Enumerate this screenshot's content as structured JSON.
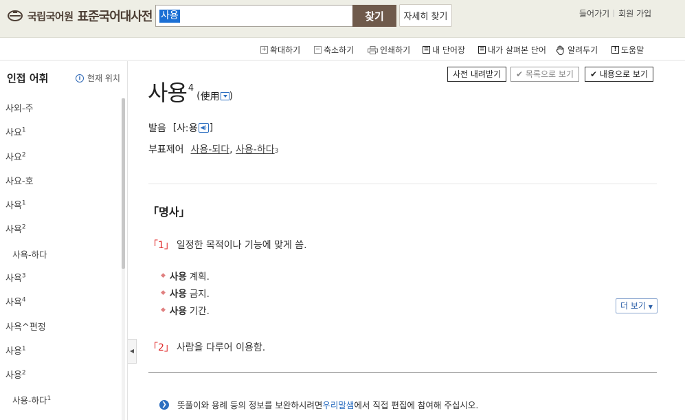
{
  "header": {
    "logo_org": "국립국어원",
    "logo_name": "표준국어대사전",
    "search_value": "사용",
    "search_button": "찾기",
    "detail_search_button": "자세히 찾기",
    "links": {
      "login": "들어가기",
      "signup": "회원 가입"
    }
  },
  "toolbar": {
    "zoom_in": "확대하기",
    "zoom_out": "축소하기",
    "print": "인쇄하기",
    "my_words": "내 단어장",
    "viewed_words": "내가 살펴본 단어",
    "report": "알려두기",
    "help": "도움말"
  },
  "sidebar": {
    "title": "인접 어휘",
    "current_location": "현재 위치",
    "items": [
      {
        "label": "사외-주",
        "sup": ""
      },
      {
        "label": "사요",
        "sup": "1"
      },
      {
        "label": "사요",
        "sup": "2"
      },
      {
        "label": "사요-호",
        "sup": ""
      },
      {
        "label": "사욕",
        "sup": "1"
      },
      {
        "label": "사욕",
        "sup": "2"
      },
      {
        "label": "사욕-하다",
        "sup": ""
      },
      {
        "label": "사욕",
        "sup": "3"
      },
      {
        "label": "사욕",
        "sup": "4"
      },
      {
        "label": "사욕^편정",
        "sup": ""
      },
      {
        "label": "사용",
        "sup": "1"
      },
      {
        "label": "사용",
        "sup": "2"
      },
      {
        "label": "사용-하다",
        "sup": "1"
      }
    ]
  },
  "main": {
    "buttons": {
      "download": "사전 내려받기",
      "list_view": "목록으로 보기",
      "content_view": "내용으로 보기"
    },
    "entry": {
      "word": "사용",
      "sup": "4",
      "hanja_open": "(",
      "hanja": "使用",
      "hanja_close": ")"
    },
    "pronunciation": {
      "label": "발음",
      "open": "[",
      "value": "사ː용",
      "close": "]"
    },
    "derivatives": {
      "label": "부표제어",
      "items": [
        "사용-되다",
        "사용-하다"
      ],
      "separator": ",",
      "last_sup": "3"
    },
    "pos": "「명사」",
    "senses": [
      {
        "num": "「1」",
        "definition": "일정한 목적이나 기능에 맞게 씀.",
        "examples": [
          {
            "head": "사용",
            "rest": "계획."
          },
          {
            "head": "사용",
            "rest": "금지."
          },
          {
            "head": "사용",
            "rest": "기간."
          }
        ],
        "more": "더 보기"
      },
      {
        "num": "「2」",
        "definition": "사람을 다루어 이용함."
      }
    ],
    "notice": {
      "before": "뜻풀이와 용례 등의 정보를 보완하시려면 ",
      "link": "우리말샘",
      "after": "에서 직접 편집에 참여해 주십시오."
    }
  }
}
